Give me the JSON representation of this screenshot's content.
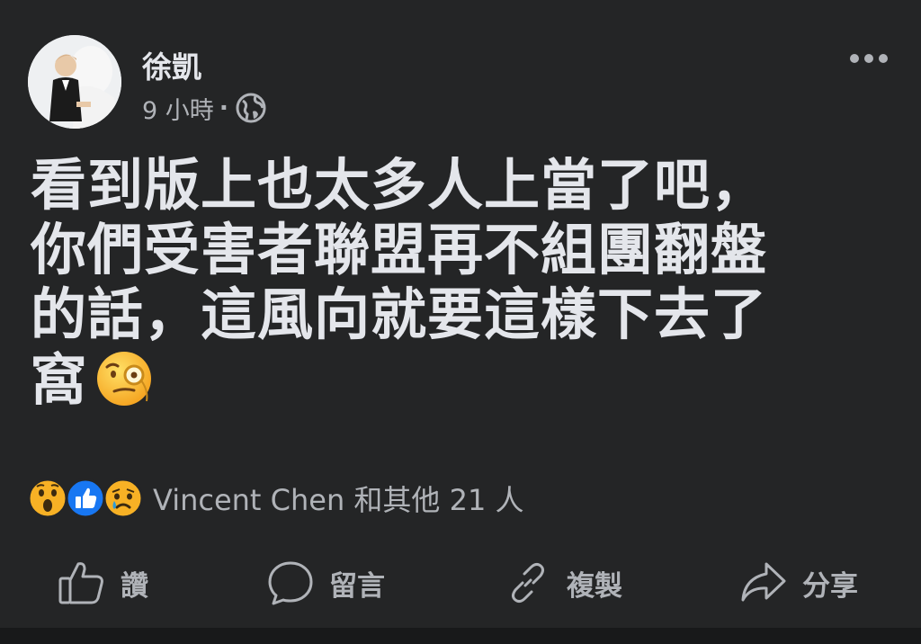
{
  "post": {
    "author": "徐凱",
    "time": "9 小時",
    "separator": "·",
    "privacy_icon": "globe-icon",
    "more_icon": "more-dots-icon",
    "content_lines": [
      "看到版上也太多人上當了吧，",
      "你們受害者聯盟再不組團翻盤",
      "的話，這風向就要這樣下去了",
      "窩"
    ],
    "content_emoji": "face-with-monocle-emoji"
  },
  "reactions": {
    "icons": [
      "wow-reaction-icon",
      "like-reaction-icon",
      "sad-reaction-icon"
    ],
    "summary": "Vincent Chen 和其他 21 人"
  },
  "actions": [
    {
      "label": "讚",
      "icon": "thumbs-up-icon"
    },
    {
      "label": "留言",
      "icon": "comment-bubble-icon"
    },
    {
      "label": "複製",
      "icon": "link-icon"
    },
    {
      "label": "分享",
      "icon": "share-arrow-icon"
    }
  ],
  "colors": {
    "background": "#242526",
    "text_primary": "#e4e6eb",
    "text_secondary": "#b0b3b8",
    "like_blue": "#1877f2",
    "reaction_yellow": "#f7b125"
  }
}
